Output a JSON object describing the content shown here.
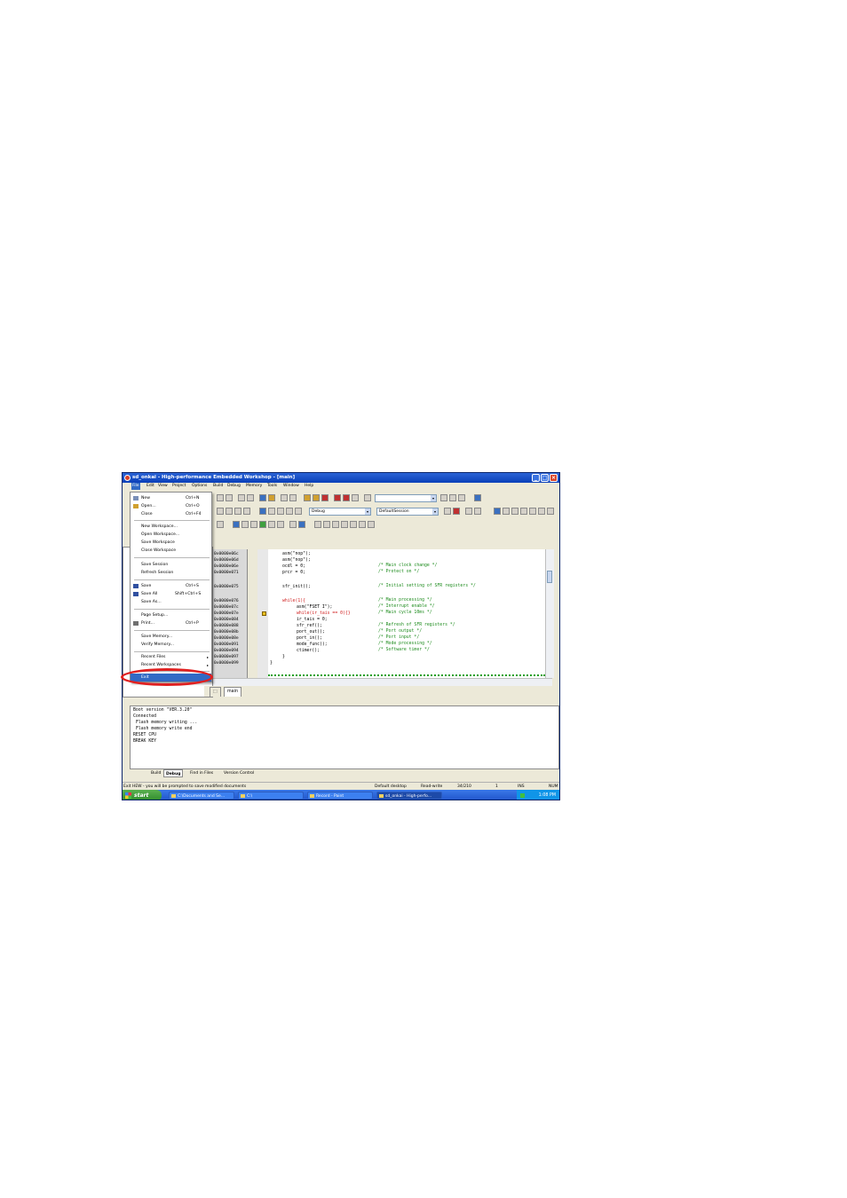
{
  "window": {
    "title": "sd_onkai - High-performance Embedded Workshop - [main]",
    "controls": {
      "minimize": "_",
      "maximize": "□",
      "close": "×"
    }
  },
  "menubar": [
    "File",
    "Edit",
    "View",
    "Project",
    "Options",
    "Build",
    "Debug",
    "Memory",
    "Tools",
    "Window",
    "Help"
  ],
  "toolbar": {
    "config_combo": "Debug",
    "session_combo": "DefaultSession"
  },
  "file_menu": {
    "items": [
      {
        "label": "New",
        "shortcut": "Ctrl+N"
      },
      {
        "label": "Open...",
        "shortcut": "Ctrl+O"
      },
      {
        "label": "Close",
        "shortcut": "Ctrl+F4"
      },
      {
        "label": "New Workspace..."
      },
      {
        "label": "Open Workspace..."
      },
      {
        "label": "Save Workspace"
      },
      {
        "label": "Close Workspace"
      },
      {
        "label": "Save Session"
      },
      {
        "label": "Refresh Session"
      },
      {
        "label": "Save",
        "shortcut": "Ctrl+S"
      },
      {
        "label": "Save All",
        "shortcut": "Shift+Ctrl+S"
      },
      {
        "label": "Save As..."
      },
      {
        "label": "Page Setup..."
      },
      {
        "label": "Print...",
        "shortcut": "Ctrl+P"
      },
      {
        "label": "Save Memory..."
      },
      {
        "label": "Verify Memory..."
      },
      {
        "label": "Recent Files",
        "submenu": "▸"
      },
      {
        "label": "Recent Workspaces",
        "submenu": "▸"
      },
      {
        "label": "Exit"
      }
    ]
  },
  "editor": {
    "addresses": [
      "0x0000e06c",
      "0x0000e06d",
      "0x0000e06e",
      "0x0000e071",
      "0x0000e075",
      "0x0000e076",
      "0x0000e07c",
      "0x0000e07e",
      "0x0000e084",
      "0x0000e088",
      "0x0000e08b",
      "0x0000e08e",
      "0x0000e091",
      "0x0000e094",
      "0x0000e097",
      "0x0000e099"
    ],
    "lines": [
      {
        "code": "asm(\"nop\");",
        "comment": ""
      },
      {
        "code": "asm(\"nop\");",
        "comment": ""
      },
      {
        "code": "ocdl = 0;",
        "comment": "/* Main clock change */"
      },
      {
        "code": "prcr = 0;",
        "comment": "/* Protect on */"
      },
      {
        "code": "sfr_init();",
        "comment": "/* Initial setting of SFR registers */"
      },
      {
        "code": "while(1){",
        "comment": "/* Main processing */"
      },
      {
        "code": "asm(\"FSET I\");",
        "comment": "/* Interrupt enable */"
      },
      {
        "code": "while(ir_tais == 0){}",
        "comment": "/* Main cycle 10ms */"
      },
      {
        "code": "ir_tais = 0;",
        "comment": ""
      },
      {
        "code": "sfr_ref();",
        "comment": "/* Refresh of SFR registers */"
      },
      {
        "code": "port_out();",
        "comment": "/* Port output */"
      },
      {
        "code": "port_in();",
        "comment": "/* Port input */"
      },
      {
        "code": "mode_func();",
        "comment": "/* Mode processing */"
      },
      {
        "code": "ctimer();",
        "comment": "/* Software timer */"
      },
      {
        "code": "}",
        "comment": ""
      },
      {
        "code": "}",
        "comment": ""
      }
    ],
    "tab": "main"
  },
  "output": {
    "lines": [
      "Boot version \"VER.3.20\"",
      "Connected",
      "Flash memory writing ...",
      "Flash memory write end",
      "RESET CPU",
      "BREAK KEY"
    ],
    "tabs": [
      "Build",
      "Debug",
      "Find in Files",
      "Version Control"
    ]
  },
  "statusbar": {
    "message": "Exit HEW - you will be prompted to save modified documents",
    "desktop": "Default desktop",
    "mode": "Read-write",
    "position": "34/210",
    "col": "1",
    "ins": "INS",
    "num": "NUM"
  },
  "taskbar": {
    "start": "start",
    "tasks": [
      "C:\\Documents and Se...",
      "C:\\",
      "Record - Paint",
      "sd_onkai - High-perfo..."
    ],
    "clock": "1:08 PM"
  },
  "colors": {
    "highlight": "#316ac5",
    "annotation_circle": "#e02020",
    "comment": "#1a8a1a"
  }
}
